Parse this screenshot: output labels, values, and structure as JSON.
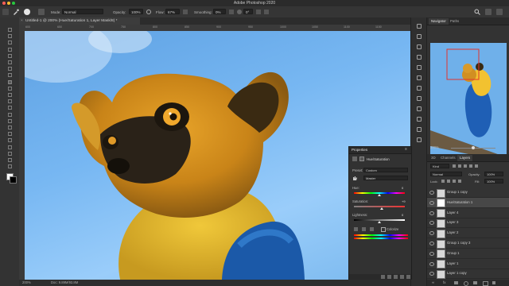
{
  "app": {
    "title": "Adobe Photoshop 2020"
  },
  "options_bar": {
    "mode_label": "Mode:",
    "mode_value": "Normal",
    "opacity_label": "Opacity:",
    "opacity_value": "100%",
    "flow_label": "Flow:",
    "flow_value": "67%",
    "smoothing_label": "Smoothing:",
    "smoothing_value": "0%",
    "angle_value": "0°"
  },
  "document": {
    "tab_title": "Untitled-1 @ 200% (Hue/Saturation 1, Layer Mask/8) *"
  },
  "ruler": {
    "ticks": [
      "600",
      "650",
      "700",
      "750",
      "800",
      "850",
      "900",
      "950",
      "1000",
      "1050",
      "1100",
      "1150"
    ]
  },
  "status": {
    "zoom": "200%",
    "doc_info": "Doc: 9.89M/93.8M"
  },
  "navigator": {
    "tabs": [
      "Navigator",
      "Paths"
    ],
    "zoom": "200%"
  },
  "layers_panel": {
    "tabs": [
      "3D",
      "Channels",
      "Layers"
    ],
    "filter_label": "Kind",
    "blend_mode": "Normal",
    "opacity_label": "Opacity:",
    "opacity_value": "100%",
    "lock_label": "Lock:",
    "fill_label": "Fill:",
    "fill_value": "100%",
    "layers": [
      {
        "name": "Group 1 copy",
        "selected": false
      },
      {
        "name": "Hue/Saturation 1",
        "selected": true
      },
      {
        "name": "Layer 4",
        "selected": false
      },
      {
        "name": "Layer 3",
        "selected": false
      },
      {
        "name": "Layer 2",
        "selected": false
      },
      {
        "name": "Group 1 copy 3",
        "selected": false
      },
      {
        "name": "Group 1",
        "selected": false
      },
      {
        "name": "Layer 1",
        "selected": false
      },
      {
        "name": "Layer 1 copy",
        "selected": false
      }
    ]
  },
  "properties_panel": {
    "title": "Properties",
    "subtitle": "Hue/Saturation",
    "preset_label": "Preset:",
    "preset_value": "Custom",
    "channel_value": "Master",
    "hue_label": "Hue:",
    "hue_value": "0",
    "saturation_label": "Saturation:",
    "saturation_value": "+9",
    "lightness_label": "Lightness:",
    "lightness_value": "0",
    "colorize_label": "Colorize",
    "hue_pos": 0.5,
    "saturation_pos": 0.54,
    "lightness_pos": 0.5
  },
  "colors": {
    "accent": "#2680eb",
    "panel": "#323232",
    "dark": "#262626"
  }
}
